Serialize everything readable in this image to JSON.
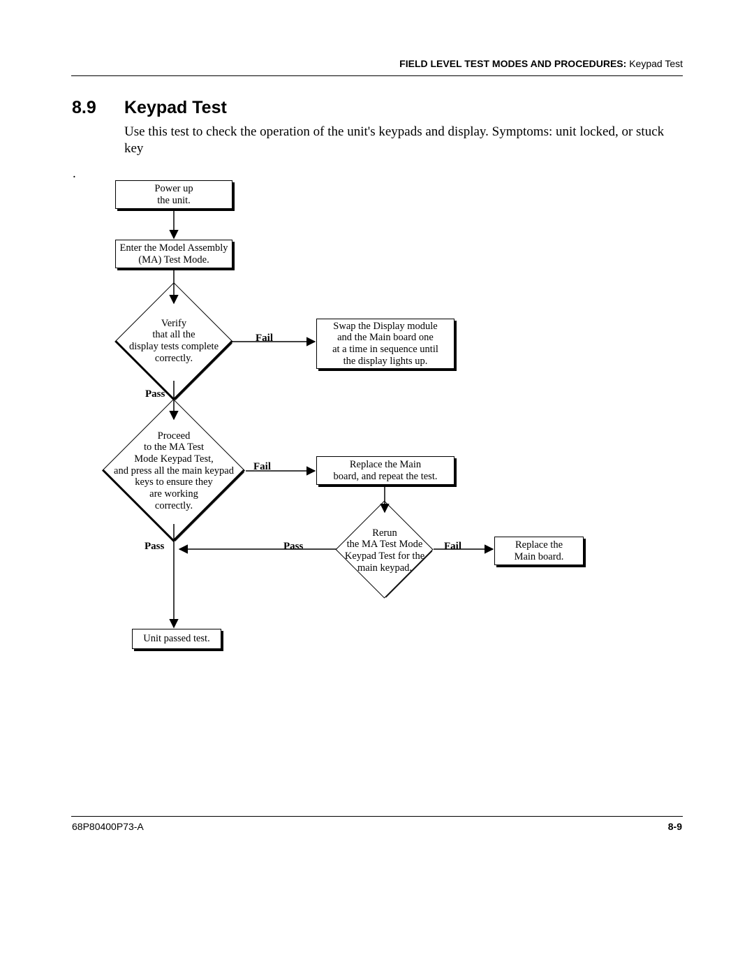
{
  "header": {
    "bold": "FIELD LEVEL TEST MODES AND PROCEDURES:",
    "rest": "  Keypad Test"
  },
  "section": {
    "num": "8.9",
    "title": "Keypad Test",
    "para": "Use this test to check the operation of the unit's keypads and display. Symptoms: unit locked, or stuck key",
    "dot": "."
  },
  "nodes": {
    "power": {
      "l1": "Power up",
      "l2": "the unit."
    },
    "enter": {
      "l1": "Enter the Model Assembly",
      "l2": "(MA) Test Mode."
    },
    "d1": {
      "l1": "Verify",
      "l2": "that all the",
      "l3": "display tests complete",
      "l4": "correctly."
    },
    "swap": {
      "l1": "Swap the Display module",
      "l2": "and the Main board one",
      "l3": "at a time in sequence until",
      "l4": "the display lights up."
    },
    "d2": {
      "l1": "Proceed",
      "l2": "to the MA Test",
      "l3": "Mode Keypad Test,",
      "l4": "and press all the main keypad",
      "l5": "keys to ensure they",
      "l6": "are working",
      "l7": "correctly."
    },
    "replace": {
      "l1": "Replace the Main",
      "l2": "board, and repeat the test."
    },
    "d3": {
      "l1": "Rerun",
      "l2": "the MA Test Mode",
      "l3": "Keypad Test for the",
      "l4": "main keypad."
    },
    "replace2": {
      "l1": "Replace the",
      "l2": "Main board."
    },
    "passed": {
      "l1": "Unit passed test."
    }
  },
  "labels": {
    "fail": "Fail",
    "pass": "Pass"
  },
  "footer": {
    "left": "68P80400P73-A",
    "right": "8-9"
  }
}
